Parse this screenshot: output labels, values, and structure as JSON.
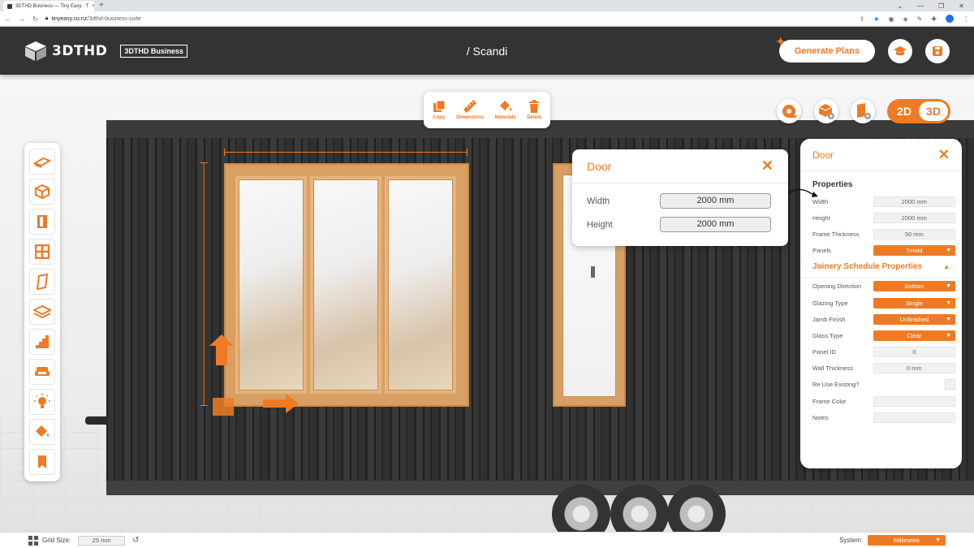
{
  "browser": {
    "tab_title": "3DTHD Business — Tiny Easy · T",
    "tab_close": "×",
    "new_tab": "+",
    "url_domain": "tinyeasy.co.nz",
    "url_path": "/3dthd-business-suite"
  },
  "header": {
    "logo_text": "3DTHD",
    "badge": "3DTHD Business",
    "title": "/ Scandi",
    "generate_label": "Generate Plans"
  },
  "action_toolbar": {
    "copy": "Copy",
    "dimensions": "Dimensions",
    "materials": "Materials",
    "delete": "Delete"
  },
  "view_toggle": {
    "option_2d": "2D",
    "option_3d": "3D",
    "active": "3D"
  },
  "quick_panel": {
    "title": "Door",
    "close": "✕",
    "width_label": "Width",
    "width_value": "2000 mm",
    "height_label": "Height",
    "height_value": "2000 mm"
  },
  "properties": {
    "title": "Door",
    "close": "✕",
    "section1": "Properties",
    "section2": "Joinery Schedule Properties",
    "section2_toggle": "▲",
    "rows": [
      {
        "label": "Width",
        "value": "2000 mm"
      },
      {
        "label": "Height",
        "value": "2000 mm"
      },
      {
        "label": "Frame Thickness",
        "value": "50 mm"
      },
      {
        "label": "Panels",
        "value": "Trifold"
      }
    ],
    "joinery": [
      {
        "label": "Opening Direction",
        "value": "Bottom"
      },
      {
        "label": "Glazing Type",
        "value": "Single"
      },
      {
        "label": "Jamb Finish",
        "value": "Unfinished"
      },
      {
        "label": "Glass Type",
        "value": "Clear"
      },
      {
        "label": "Panel ID",
        "value": "0"
      },
      {
        "label": "Wall Thickness",
        "value": "0 mm"
      },
      {
        "label": "Re Use Existing?",
        "value": ""
      },
      {
        "label": "Frame Color",
        "value": ""
      },
      {
        "label": "Notes",
        "value": ""
      }
    ]
  },
  "statusbar": {
    "grid_label": "Grid Size:",
    "grid_value": "25 mm",
    "reset_icon": "↺",
    "system_label": "System:",
    "system_value": "Millimetre"
  },
  "colors": {
    "accent": "#ee7b24",
    "header_bg": "#333333",
    "cladding": "#2b2b2b",
    "timber": "#d8a063"
  }
}
